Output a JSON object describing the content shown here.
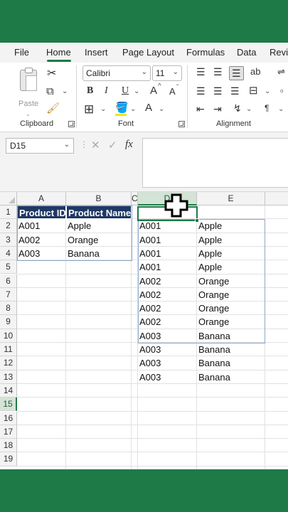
{
  "ribbon_tabs": [
    "File",
    "Home",
    "Insert",
    "Page Layout",
    "Formulas",
    "Data",
    "Revi"
  ],
  "active_tab": "Home",
  "clipboard": {
    "paste_label": "Paste",
    "group_label": "Clipboard"
  },
  "font": {
    "name": "Calibri",
    "size": "11",
    "group_label": "Font",
    "bold": "B",
    "italic": "I",
    "underline": "U",
    "grow": "A",
    "shrink": "A",
    "color_letter": "A"
  },
  "alignment": {
    "group_label": "Alignment"
  },
  "formula_bar": {
    "name_box": "D15",
    "value": ""
  },
  "columns": [
    "A",
    "B",
    "C",
    "D",
    "E"
  ],
  "selected_column": "D",
  "rows": [
    "1",
    "2",
    "3",
    "4",
    "5",
    "6",
    "7",
    "8",
    "9",
    "10",
    "11",
    "12",
    "13",
    "14",
    "15",
    "16",
    "17",
    "18",
    "19"
  ],
  "selected_row": "15",
  "source_table": {
    "headers": [
      "Product ID",
      "Product Name"
    ],
    "rows": [
      [
        "A001",
        "Apple"
      ],
      [
        "A002",
        "Orange"
      ],
      [
        "A003",
        "Banana"
      ]
    ]
  },
  "expanded_list": [
    [
      "A001",
      "Apple"
    ],
    [
      "A001",
      "Apple"
    ],
    [
      "A001",
      "Apple"
    ],
    [
      "A001",
      "Apple"
    ],
    [
      "A002",
      "Orange"
    ],
    [
      "A002",
      "Orange"
    ],
    [
      "A002",
      "Orange"
    ],
    [
      "A002",
      "Orange"
    ],
    [
      "A003",
      "Banana"
    ],
    [
      "A003",
      "Banana"
    ],
    [
      "A003",
      "Banana"
    ],
    [
      "A003",
      "Banana"
    ]
  ],
  "colors": {
    "accent": "#1e7a46",
    "table_header": "#1f3864",
    "table_border": "#8ea9c9"
  }
}
